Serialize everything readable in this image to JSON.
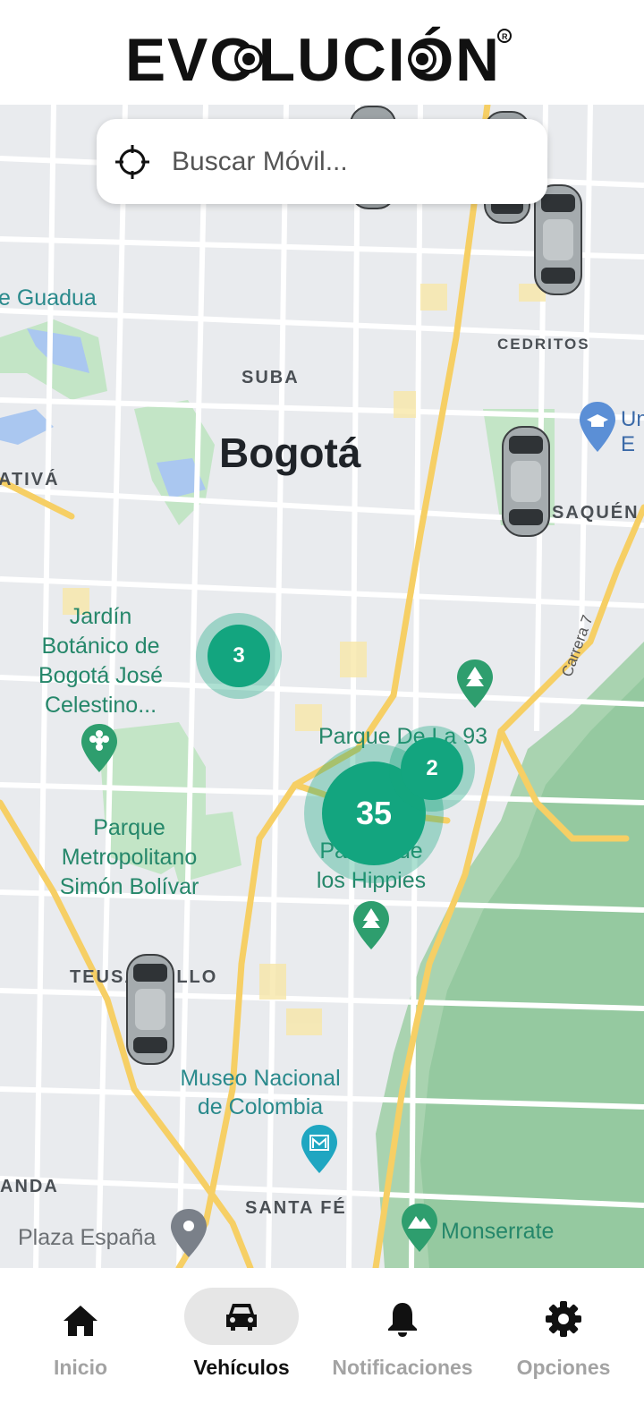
{
  "header": {
    "logo_text": "EVOLUCIÓN"
  },
  "search": {
    "placeholder": "Buscar Móvil..."
  },
  "map": {
    "city": "Bogotá",
    "districts": [
      "SUBA",
      "CEDRITOS",
      "SAQUÉN",
      "ATIVÁ",
      "TEUSAQUILLO",
      "ANDA",
      "SANTA FÉ"
    ],
    "places": {
      "guadua": "e Guadua",
      "jardin": "Jardín\nBotánico de\nBogotá José\nCelestino...",
      "parque93": "Parque De La 93",
      "hippies": "Parque de\nlos Hippies",
      "simon": "Parque\nMetropolitano\nSimón Bolívar",
      "museo": "Museo Nacional\nde Colombia",
      "plaza": "Plaza España",
      "monserrate": "Monserrate",
      "carrera": "Carrera 7",
      "uni_edge": "Un\nE"
    },
    "clusters": [
      "3",
      "35",
      "2"
    ]
  },
  "nav": {
    "items": [
      {
        "label": "Inicio",
        "icon": "home-icon"
      },
      {
        "label": "Vehículos",
        "icon": "car-icon"
      },
      {
        "label": "Notificaciones",
        "icon": "bell-icon"
      },
      {
        "label": "Opciones",
        "icon": "gear-icon"
      }
    ],
    "active_index": 1
  },
  "colors": {
    "accent": "#13a57f",
    "park": "#c8e6c9",
    "road": "#f6cf65"
  }
}
